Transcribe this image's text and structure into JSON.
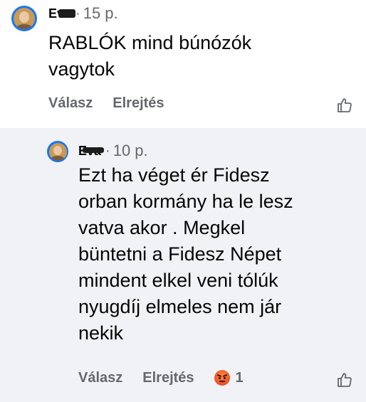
{
  "comments": [
    {
      "author": "Eva",
      "time": "15 p.",
      "text": "RABLÓK  mind búnózók\nvagytok",
      "actions": {
        "reply": "Válasz",
        "hide": "Elrejtés"
      },
      "like_icon": "thumbs-up-icon"
    },
    {
      "author": "Eva",
      "time": "10 p.",
      "text": "Ezt ha véget ér  Fidesz\norban kormány ha le lesz\nvatva akor . Megkel\nbüntetni a Fidesz Népet\nmindent elkel veni tólúk\nnyugdíj elmeles  nem jár\nnekik",
      "actions": {
        "reply": "Válasz",
        "hide": "Elrejtés"
      },
      "reaction": {
        "icon": "angry-reaction-icon",
        "count": "1"
      },
      "like_icon": "thumbs-up-icon"
    }
  ],
  "colors": {
    "reply_background": "#f0f2f5",
    "secondary_text": "#65676b",
    "avatar_ring": "#1877f2",
    "angry_reaction": "#f05a2c"
  }
}
